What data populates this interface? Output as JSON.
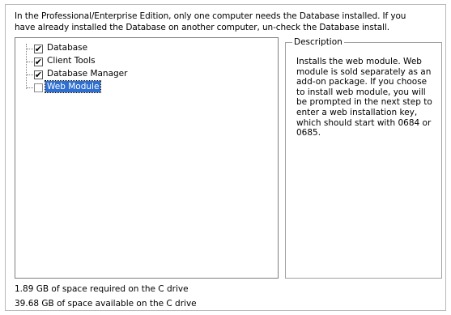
{
  "intro": {
    "line1": "In the Professional/Enterprise Edition, only one computer needs the Database installed. If you",
    "line2": "have already installed the Database on another computer, un-check the Database install."
  },
  "components": [
    {
      "label": "Database",
      "checked": true,
      "selected": false
    },
    {
      "label": "Client Tools",
      "checked": true,
      "selected": false
    },
    {
      "label": "Database Manager",
      "checked": true,
      "selected": false
    },
    {
      "label": "Web Module",
      "checked": false,
      "selected": true
    }
  ],
  "description": {
    "title": "Description",
    "lines": [
      "Installs the web module. Web",
      "module is sold separately as an",
      "add-on package. If you choose",
      "to install web module, you will",
      "be prompted in the next step to",
      "enter a web installation key,",
      "which should start with 0684 or",
      "0685."
    ]
  },
  "space": {
    "required": "1.89 GB of space required on the C drive",
    "available": "39.68 GB of space available on the C drive"
  }
}
